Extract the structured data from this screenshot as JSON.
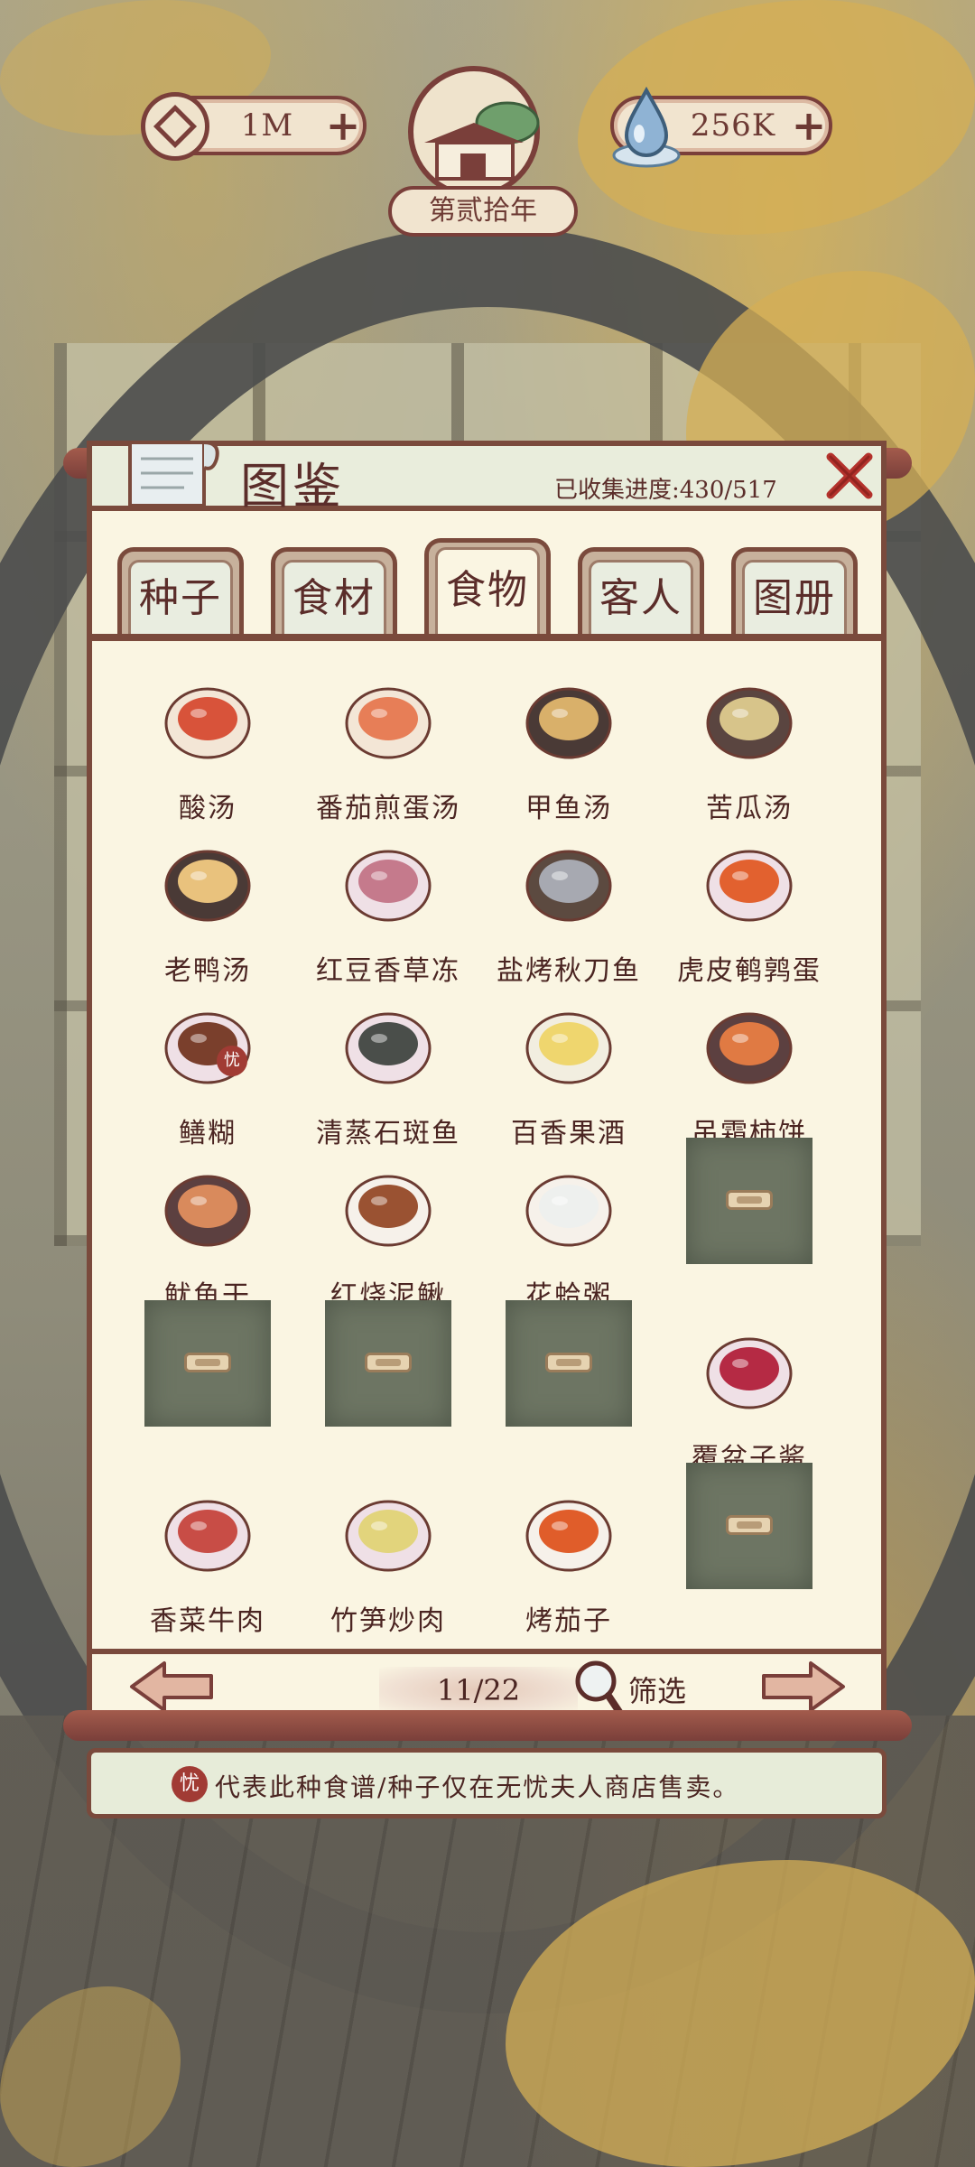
{
  "hud": {
    "coins": "1M",
    "water": "256K",
    "plus": "+",
    "era": "第贰拾年"
  },
  "panel": {
    "title": "图鉴",
    "progress": "已收集进度:430/517"
  },
  "tabs": [
    {
      "label": "种子"
    },
    {
      "label": "食材"
    },
    {
      "label": "食物"
    },
    {
      "label": "客人"
    },
    {
      "label": "图册"
    }
  ],
  "active_tab": "食物",
  "items": [
    {
      "name": "酸汤",
      "state": "unlocked",
      "icon": "sour-soup-icon"
    },
    {
      "name": "番茄煎蛋汤",
      "state": "unlocked",
      "icon": "tomato-egg-soup-icon"
    },
    {
      "name": "甲鱼汤",
      "state": "unlocked",
      "icon": "turtle-soup-icon"
    },
    {
      "name": "苦瓜汤",
      "state": "unlocked",
      "icon": "bitter-melon-soup-icon"
    },
    {
      "name": "老鸭汤",
      "state": "unlocked",
      "icon": "duck-soup-icon"
    },
    {
      "name": "红豆香草冻",
      "state": "unlocked",
      "icon": "red-bean-jelly-icon"
    },
    {
      "name": "盐烤秋刀鱼",
      "state": "unlocked",
      "icon": "grilled-saury-icon"
    },
    {
      "name": "虎皮鹌鹑蛋",
      "state": "unlocked",
      "icon": "quail-egg-icon"
    },
    {
      "name": "鳝糊",
      "state": "unlocked",
      "icon": "eel-paste-icon"
    },
    {
      "name": "清蒸石斑鱼",
      "state": "unlocked",
      "icon": "steamed-grouper-icon"
    },
    {
      "name": "百香果酒",
      "state": "unlocked",
      "icon": "passion-fruit-wine-icon"
    },
    {
      "name": "吊霜柿饼",
      "state": "unlocked",
      "icon": "dried-persimmon-icon"
    },
    {
      "name": "鱿鱼干",
      "state": "unlocked",
      "icon": "dried-squid-icon"
    },
    {
      "name": "红烧泥鳅",
      "state": "unlocked",
      "icon": "braised-loach-icon"
    },
    {
      "name": "花蛤粥",
      "state": "unlocked",
      "icon": "clam-porridge-icon"
    },
    {
      "name": "",
      "state": "locked"
    },
    {
      "name": "",
      "state": "locked"
    },
    {
      "name": "",
      "state": "locked"
    },
    {
      "name": "",
      "state": "locked"
    },
    {
      "name": "覆盆子酱",
      "state": "unlocked",
      "icon": "raspberry-jam-icon"
    },
    {
      "name": "香菜牛肉",
      "state": "unlocked",
      "icon": "cilantro-beef-icon"
    },
    {
      "name": "竹笋炒肉",
      "state": "unlocked",
      "icon": "bamboo-shoot-pork-icon"
    },
    {
      "name": "烤茄子",
      "state": "unlocked",
      "icon": "grilled-eggplant-icon"
    },
    {
      "name": "",
      "state": "locked"
    }
  ],
  "shop_badge": "忧",
  "pager": {
    "page": "11/22",
    "filter": "筛选"
  },
  "footer_note": "代表此种食谱/种子仅在无忧夫人商店售卖。",
  "colors": {
    "frame": "#7a4a3c",
    "paper": "#faf5e2",
    "text": "#4b2522",
    "locked": "#6d7563",
    "shop_badge": "#a13b34"
  }
}
